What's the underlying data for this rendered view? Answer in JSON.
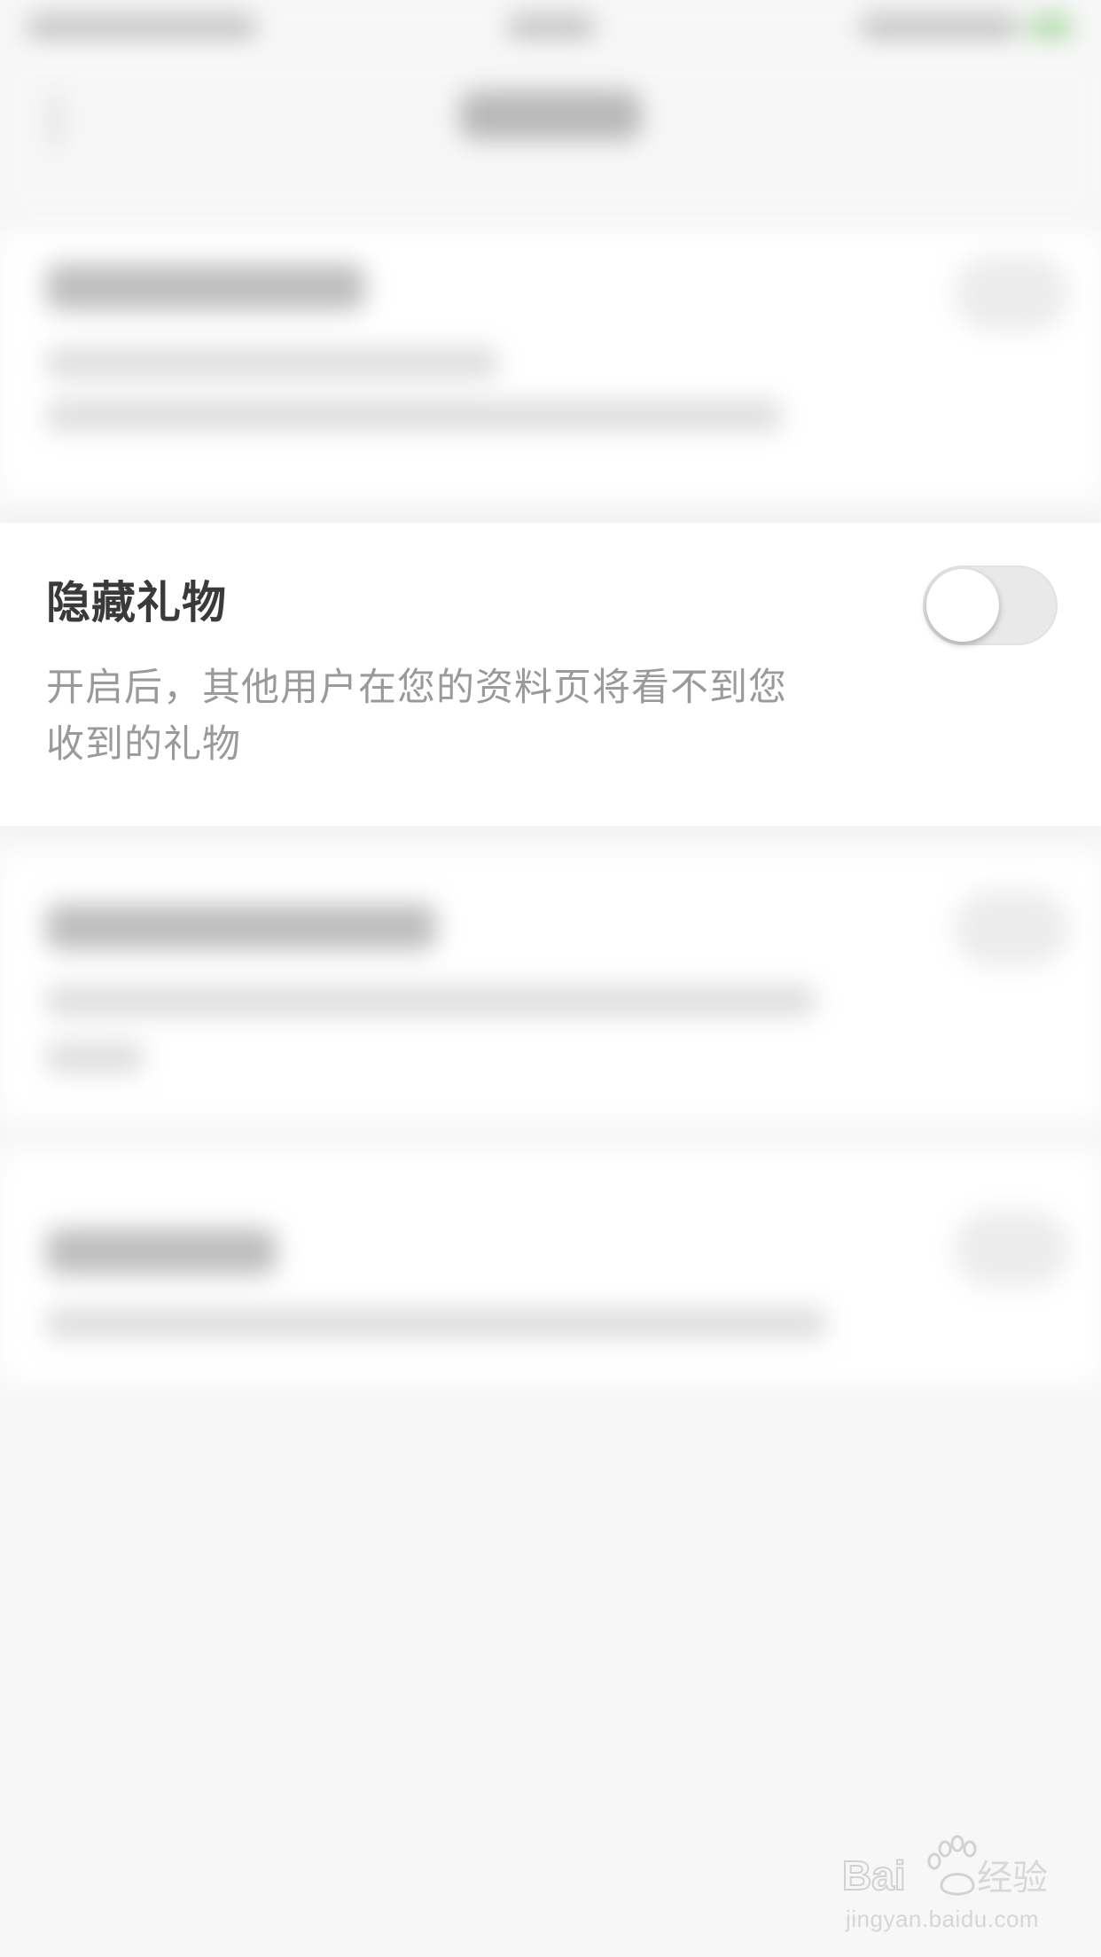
{
  "setting": {
    "title": "隐藏礼物",
    "description_line1": "开启后，其他用户在您的资料页将看不到您",
    "description_line2": "收到的礼物",
    "toggle_on": false
  },
  "watermark": {
    "logo_text": "Bai经验",
    "url": "jingyan.baidu.com"
  },
  "colors": {
    "background": "#f7f7f7",
    "card": "#ffffff",
    "title": "#3a3a3a",
    "description": "#9a9a9a",
    "toggle_off": "#e9e9e9"
  }
}
